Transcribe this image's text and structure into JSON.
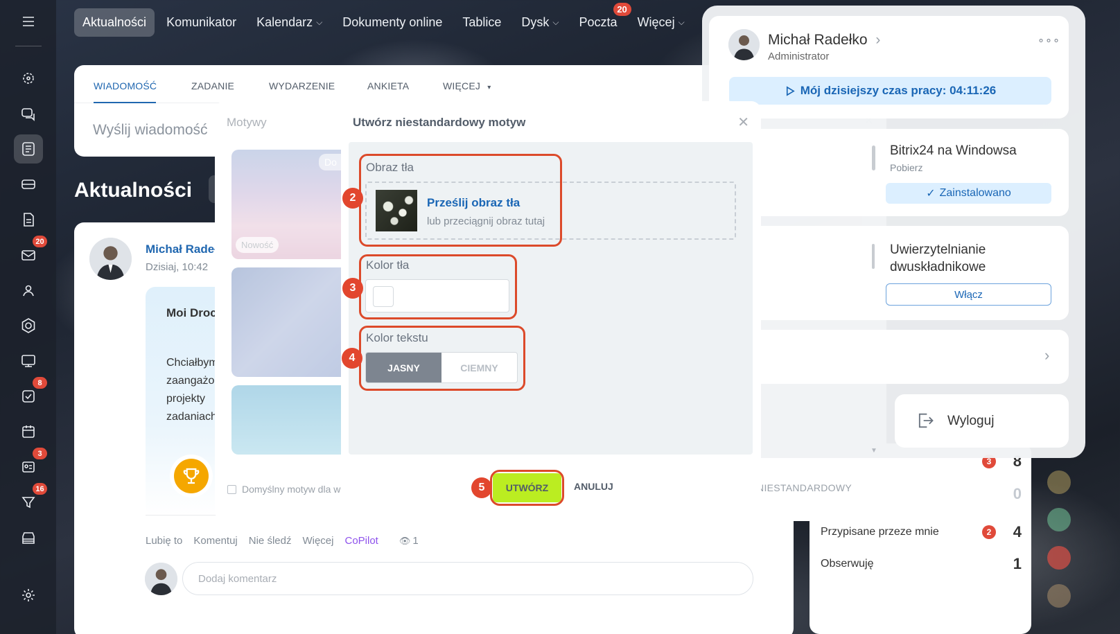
{
  "nav": {
    "items": [
      {
        "label": "Aktualności",
        "active": true,
        "chevron": false,
        "badge": ""
      },
      {
        "label": "Komunikator",
        "active": false,
        "chevron": false,
        "badge": ""
      },
      {
        "label": "Kalendarz",
        "active": false,
        "chevron": true,
        "badge": ""
      },
      {
        "label": "Dokumenty online",
        "active": false,
        "chevron": false,
        "badge": ""
      },
      {
        "label": "Tablice",
        "active": false,
        "chevron": false,
        "badge": ""
      },
      {
        "label": "Dysk",
        "active": false,
        "chevron": true,
        "badge": ""
      },
      {
        "label": "Poczta",
        "active": false,
        "chevron": false,
        "badge": "20"
      },
      {
        "label": "Więcej",
        "active": false,
        "chevron": true,
        "badge": ""
      }
    ]
  },
  "sidebar": {
    "badges": {
      "mail": "20",
      "tasks": "8",
      "news": "3",
      "funnel": "16"
    }
  },
  "composer": {
    "tabs": [
      "WIADOMOŚĆ",
      "ZADANIE",
      "WYDARZENIE",
      "ANKIETA",
      "WIĘCEJ"
    ],
    "placeholder": "Wyślij wiadomość"
  },
  "page": {
    "title": "Aktualności"
  },
  "post": {
    "author": "Michał Radeł",
    "date": "Dzisiaj, 10:42",
    "greeting": "Moi Droc",
    "lines": [
      "Chciałbym",
      "zaangażo",
      "projekty",
      "zadaniach"
    ],
    "actions": {
      "like": "Lubię to",
      "comment": "Komentuj",
      "unfollow": "Nie śledź",
      "more": "Więcej",
      "copilot": "CoPilot",
      "views": "1"
    },
    "comment_placeholder": "Dodaj komentarz"
  },
  "tasks_widget": {
    "rows": [
      {
        "label": "",
        "count": "3",
        "value": "8"
      },
      {
        "label": "",
        "count": "",
        "value": "0"
      },
      {
        "label": "Przypisane przeze mnie",
        "count": "2",
        "value": "4"
      },
      {
        "label": "Obserwuję",
        "count": "",
        "value": "1"
      }
    ]
  },
  "themes_dialog": {
    "title": "Motywy",
    "tag_new": "Nowość",
    "tag_partial": "Do",
    "default_checkbox": "Domyślny motyw dla w",
    "custom_button": "NIESTANDARDOWY"
  },
  "modal": {
    "title": "Utwórz niestandardowy motyw",
    "bg_image_label": "Obraz tła",
    "upload_link": "Prześlij obraz tła",
    "upload_hint": "lub przeciągnij obraz tutaj",
    "bg_color_label": "Kolor tła",
    "text_color_label": "Kolor tekstu",
    "light": "JASNY",
    "dark": "CIEMNY",
    "create": "UTWÓRZ",
    "cancel": "ANULUJ"
  },
  "steps": [
    "2",
    "3",
    "4",
    "5"
  ],
  "user_panel": {
    "name": "Michał Radełko",
    "role": "Administrator",
    "work_time": "Mój dzisiejszy czas pracy: 04:11:26",
    "bitrix_title": "Bitrix24 na Windowsa",
    "bitrix_sub": "Pobierz",
    "installed": "Zainstalowano",
    "twofa_title": "Uwierzytelnianie dwuskładnikowe",
    "enable": "Włącz",
    "logout": "Wyloguj"
  },
  "colors": {
    "accent": "#2067b0",
    "highlight": "#dc4a2a",
    "create_button": "#bbed21",
    "badge": "#e04a3a"
  }
}
